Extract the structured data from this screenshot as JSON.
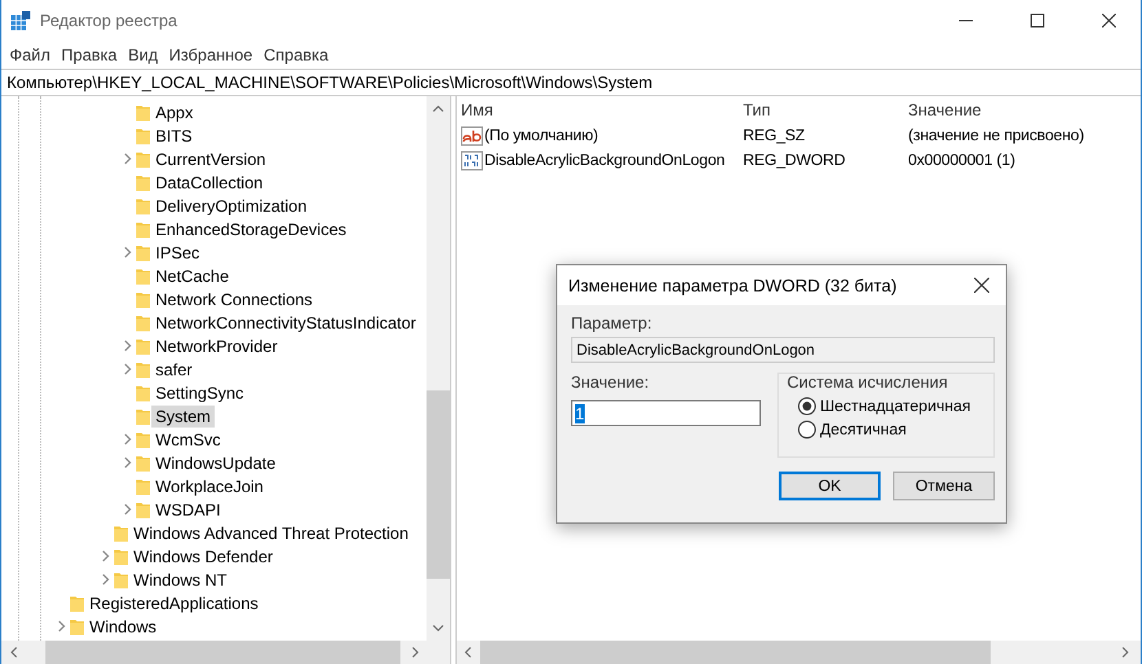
{
  "window": {
    "title": "Редактор реестра"
  },
  "menu": [
    "Файл",
    "Правка",
    "Вид",
    "Избранное",
    "Справка"
  ],
  "address": "Компьютер\\HKEY_LOCAL_MACHINE\\SOFTWARE\\Policies\\Microsoft\\Windows\\System",
  "tree": [
    {
      "children": [
        {
          "children": [
            {
              "children": [
                {
                  "label": "Appx",
                  "expandable": false,
                  "selected": false
                },
                {
                  "label": "BITS",
                  "expandable": false,
                  "selected": false
                },
                {
                  "label": "CurrentVersion",
                  "expandable": true,
                  "selected": false
                },
                {
                  "label": "DataCollection",
                  "expandable": false,
                  "selected": false
                },
                {
                  "label": "DeliveryOptimization",
                  "expandable": false,
                  "selected": false
                },
                {
                  "label": "EnhancedStorageDevices",
                  "expandable": false,
                  "selected": false
                },
                {
                  "label": "IPSec",
                  "expandable": true,
                  "selected": false
                },
                {
                  "label": "NetCache",
                  "expandable": false,
                  "selected": false
                },
                {
                  "label": "Network Connections",
                  "expandable": false,
                  "selected": false
                },
                {
                  "label": "NetworkConnectivityStatusIndicator",
                  "expandable": false,
                  "selected": false
                },
                {
                  "label": "NetworkProvider",
                  "expandable": true,
                  "selected": false
                },
                {
                  "label": "safer",
                  "expandable": true,
                  "selected": false
                },
                {
                  "label": "SettingSync",
                  "expandable": false,
                  "selected": false
                },
                {
                  "label": "System",
                  "expandable": false,
                  "selected": true
                },
                {
                  "label": "WcmSvc",
                  "expandable": true,
                  "selected": false
                },
                {
                  "label": "WindowsUpdate",
                  "expandable": true,
                  "selected": false
                },
                {
                  "label": "WorkplaceJoin",
                  "expandable": false,
                  "selected": false
                },
                {
                  "label": "WSDAPI",
                  "expandable": true,
                  "selected": false
                }
              ]
            },
            {
              "label": "Windows Advanced Threat Protection",
              "expandable": false,
              "selected": false
            },
            {
              "label": "Windows Defender",
              "expandable": true,
              "selected": false
            },
            {
              "label": "Windows NT",
              "expandable": true,
              "selected": false
            }
          ]
        }
      ]
    },
    {
      "label": "RegisteredApplications",
      "expandable": false,
      "selected": false
    },
    {
      "label": "Windows",
      "expandable": true,
      "selected": false
    }
  ],
  "values": {
    "columns": [
      "Имя",
      "Тип",
      "Значение"
    ],
    "rows": [
      {
        "kind": "string",
        "name": "(По умолчанию)",
        "type": "REG_SZ",
        "data": "(значение не присвоено)"
      },
      {
        "kind": "binary",
        "name": "DisableAcrylicBackgroundOnLogon",
        "type": "REG_DWORD",
        "data": "0x00000001 (1)"
      }
    ]
  },
  "dialog": {
    "title": "Изменение параметра DWORD (32 бита)",
    "param_label": "Параметр:",
    "param_value": "DisableAcrylicBackgroundOnLogon",
    "value_label": "Значение:",
    "value": "1",
    "value_selected": true,
    "base": {
      "title": "Система исчисления",
      "options": [
        {
          "label": "Шестнадцатеричная",
          "selected": true
        },
        {
          "label": "Десятичная",
          "selected": false
        }
      ]
    },
    "buttons": [
      {
        "label": "OK",
        "default": true
      },
      {
        "label": "Отмена",
        "default": false
      }
    ]
  }
}
